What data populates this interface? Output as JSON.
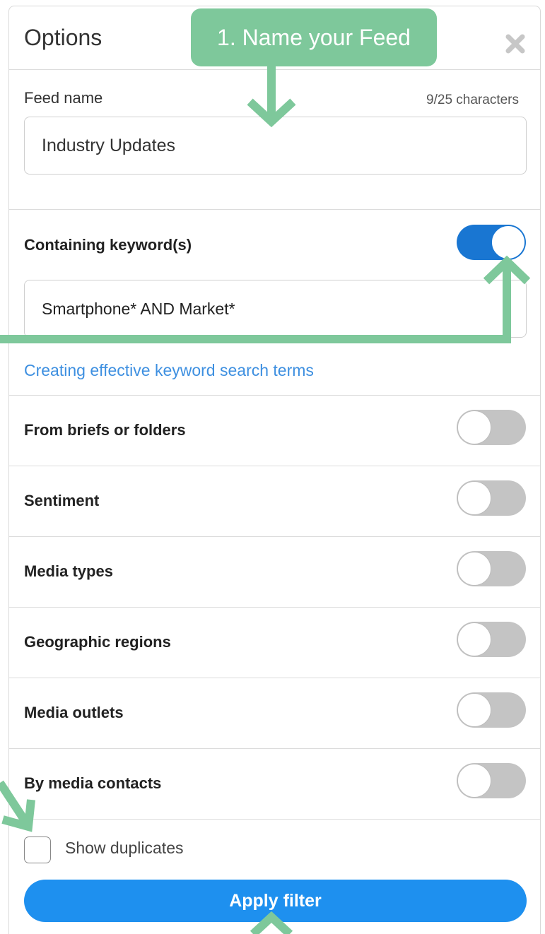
{
  "panel": {
    "title": "Options",
    "close_icon": "close-icon"
  },
  "feed_name": {
    "label": "Feed name",
    "char_count": "9/25 characters",
    "value": "Industry Updates"
  },
  "keywords": {
    "label": "Containing keyword(s)",
    "enabled": true,
    "value": "Smartphone* AND Market*",
    "help_link": "Creating effective keyword search terms"
  },
  "filters": [
    {
      "label": "From briefs or folders",
      "enabled": false
    },
    {
      "label": "Sentiment",
      "enabled": false
    },
    {
      "label": "Media types",
      "enabled": false
    },
    {
      "label": "Geographic regions",
      "enabled": false
    },
    {
      "label": "Media outlets",
      "enabled": false
    },
    {
      "label": "By media contacts",
      "enabled": false
    }
  ],
  "show_duplicates": {
    "label": "Show duplicates",
    "checked": false
  },
  "apply_button": {
    "label": "Apply filter"
  },
  "annotation": {
    "callout_text": "1. Name your Feed",
    "color": "#7ec89b"
  },
  "colors": {
    "toggle_on": "#1976d2",
    "toggle_off": "#c4c4c4",
    "link": "#3d8fe0",
    "apply_button": "#1e90ef"
  }
}
